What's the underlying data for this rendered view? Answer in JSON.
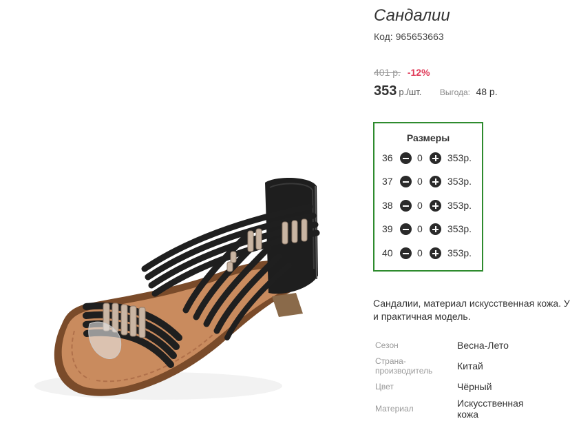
{
  "product": {
    "title": "Сандалии",
    "sku": "Код: 965653663",
    "old_price": "401 р.",
    "discount": "-12%",
    "price": "353",
    "price_unit": "р./шт.",
    "saving_label": "Выгода:",
    "saving_value": "48 р."
  },
  "sizes": {
    "title": "Размеры",
    "rows": [
      {
        "size": "36",
        "qty": "0",
        "price": "353р."
      },
      {
        "size": "37",
        "qty": "0",
        "price": "353р."
      },
      {
        "size": "38",
        "qty": "0",
        "price": "353р."
      },
      {
        "size": "39",
        "qty": "0",
        "price": "353р."
      },
      {
        "size": "40",
        "qty": "0",
        "price": "353р."
      }
    ]
  },
  "description": {
    "line1": "Сандалии, материал искусственная кожа. У",
    "line2": "и практичная модель."
  },
  "attributes": [
    {
      "label": "Сезон",
      "value": "Весна-Лето"
    },
    {
      "label_line1": "Страна-",
      "label_line2": "производитель",
      "value": "Китай"
    },
    {
      "label": "Цвет",
      "value": "Чёрный"
    },
    {
      "label": "Материал",
      "value_line1": "Искусственная",
      "value_line2": "кожа"
    }
  ],
  "colors": {
    "accent_border": "#2e8b2e",
    "discount": "#e03c5a"
  }
}
